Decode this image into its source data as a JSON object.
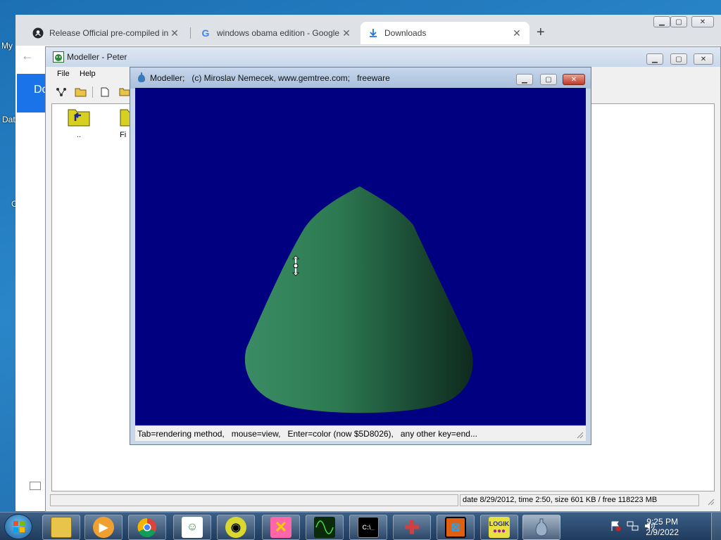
{
  "desktop": {
    "frag_my": "My",
    "frag_dat": "Dat",
    "frag_c": "C"
  },
  "chrome": {
    "tabs": [
      {
        "label": "Release Official pre-compiled ins",
        "icon": "github-icon"
      },
      {
        "label": "windows obama edition - Google",
        "icon": "google-icon"
      },
      {
        "label": "Downloads",
        "icon": "download-icon"
      }
    ],
    "new_tab": "+",
    "back": "←",
    "page_fragment": "Do"
  },
  "peter": {
    "title": "Modeller - Peter",
    "menu": [
      "File",
      "Help"
    ],
    "folders": [
      {
        "label": ".."
      },
      {
        "label": "Fi"
      }
    ],
    "status": "date 8/29/2012, time 2:50, size 601 KB / free 118223 MB"
  },
  "viewer": {
    "title": "Modeller;   (c) Miroslav Nemecek, www.gemtree.com;   freeware",
    "status": "Tab=rendering method,   mouse=view,   Enter=color (now $5D8026),   any other key=end...",
    "background_color": "#000080",
    "cone_color_light": "#3a8c64",
    "cone_color_dark": "#0f2a1e"
  },
  "taskbar": {
    "apps": [
      "explorer-icon",
      "media-player-icon",
      "chrome-icon",
      "bunny-game-icon",
      "alien-game-icon",
      "x-game-icon",
      "oscilloscope-icon",
      "console-icon",
      "cross-puzzle-icon",
      "puzzle-icon",
      "logik-icon",
      "modeller-icon"
    ],
    "logik_text": "LOGIK",
    "clock_time": "9:25 PM",
    "clock_date": "2/9/2022"
  }
}
